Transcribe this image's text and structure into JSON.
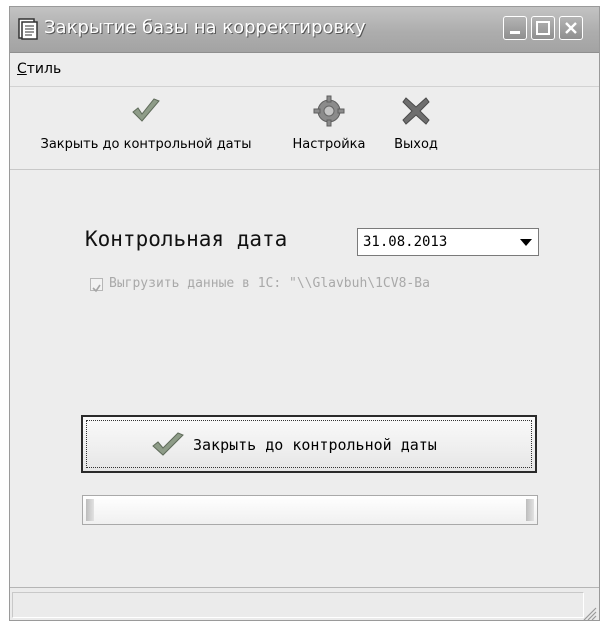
{
  "window": {
    "title": "Закрытие базы на корректировку",
    "controls": {
      "minimize": "minimize-icon",
      "maximize": "maximize-icon",
      "close": "close-icon"
    }
  },
  "menu": {
    "style_prefix": "С",
    "style_rest": "тиль"
  },
  "toolbar": {
    "close_to_date": {
      "label": "Закрыть до контрольной даты",
      "icon": "checkmark-icon"
    },
    "settings": {
      "label": "Настройка",
      "icon": "gear-icon"
    },
    "exit": {
      "label": "Выход",
      "icon": "x-icon"
    }
  },
  "form": {
    "control_date_label": "Контрольная дата",
    "control_date_value": "31.08.2013",
    "export_checked": true,
    "export_label": "Выгрузить данные в 1С: \"\\\\Glavbuh\\1CV8-Ba"
  },
  "main_button": {
    "label": "Закрыть до контрольной даты",
    "icon": "checkmark-icon"
  },
  "progress": {
    "value": 0
  },
  "colors": {
    "title_text": "#ffffff",
    "disabled_text": "#a9a9a9",
    "window_bg": "#ededed"
  }
}
